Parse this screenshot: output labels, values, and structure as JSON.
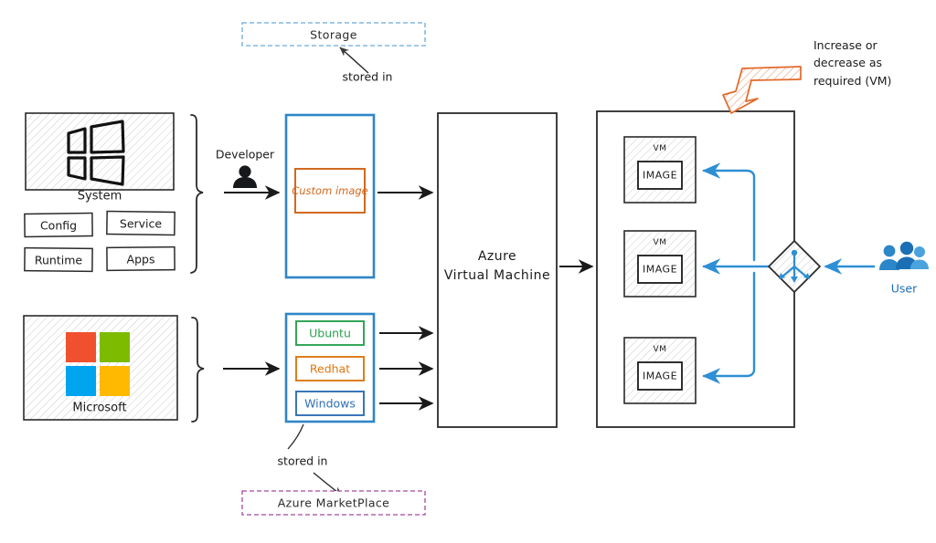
{
  "diagram": {
    "title_note": "Increase or decrease as required (VM)",
    "labels": {
      "storage": "Storage",
      "marketplace": "Azure MarketPlace",
      "stored_in_top": "stored in",
      "stored_in_bottom": "stored in",
      "developer": "Developer",
      "system": "System",
      "microsoft": "Microsoft",
      "custom_image": "Custom image",
      "azure_vm_line1": "Azure",
      "azure_vm_line2": "Virtual Machine",
      "user": "User",
      "note_line1": "Increase or",
      "note_line2": "decrease as",
      "note_line3": "required (VM)"
    },
    "system_components": [
      {
        "label": "Config"
      },
      {
        "label": "Service"
      },
      {
        "label": "Runtime"
      },
      {
        "label": "Apps"
      }
    ],
    "marketplace_images": [
      {
        "label": "Ubuntu",
        "color": "#2aa14f"
      },
      {
        "label": "Redhat",
        "color": "#dd7711"
      },
      {
        "label": "Windows",
        "color": "#2f6fb5"
      }
    ],
    "vm_instances": [
      {
        "title": "VM",
        "image_label": "IMAGE"
      },
      {
        "title": "VM",
        "image_label": "IMAGE"
      },
      {
        "title": "VM",
        "image_label": "IMAGE"
      }
    ],
    "icons": {
      "developer": "person-icon",
      "user": "users-group-icon",
      "load_balancer": "load-balancer-icon",
      "windows_logo": "windows-logo-icon",
      "microsoft_logo": "microsoft-logo-icon",
      "scale_arrow": "scale-arrow-icon"
    },
    "colors": {
      "storage_border": "#6aa9dc",
      "marketplace_border": "#a347a3",
      "container_blue": "#2f86c8",
      "custom_image": "#d2691e",
      "flow_blue": "#2e8fd4",
      "user_blue": "#2b87c8",
      "scale_orange": "#e2692a",
      "ms_red": "#f1502f",
      "ms_green": "#7cbb00",
      "ms_blue": "#00a4ef",
      "ms_yellow": "#ffb900",
      "stroke": "#1a1a1a"
    }
  }
}
